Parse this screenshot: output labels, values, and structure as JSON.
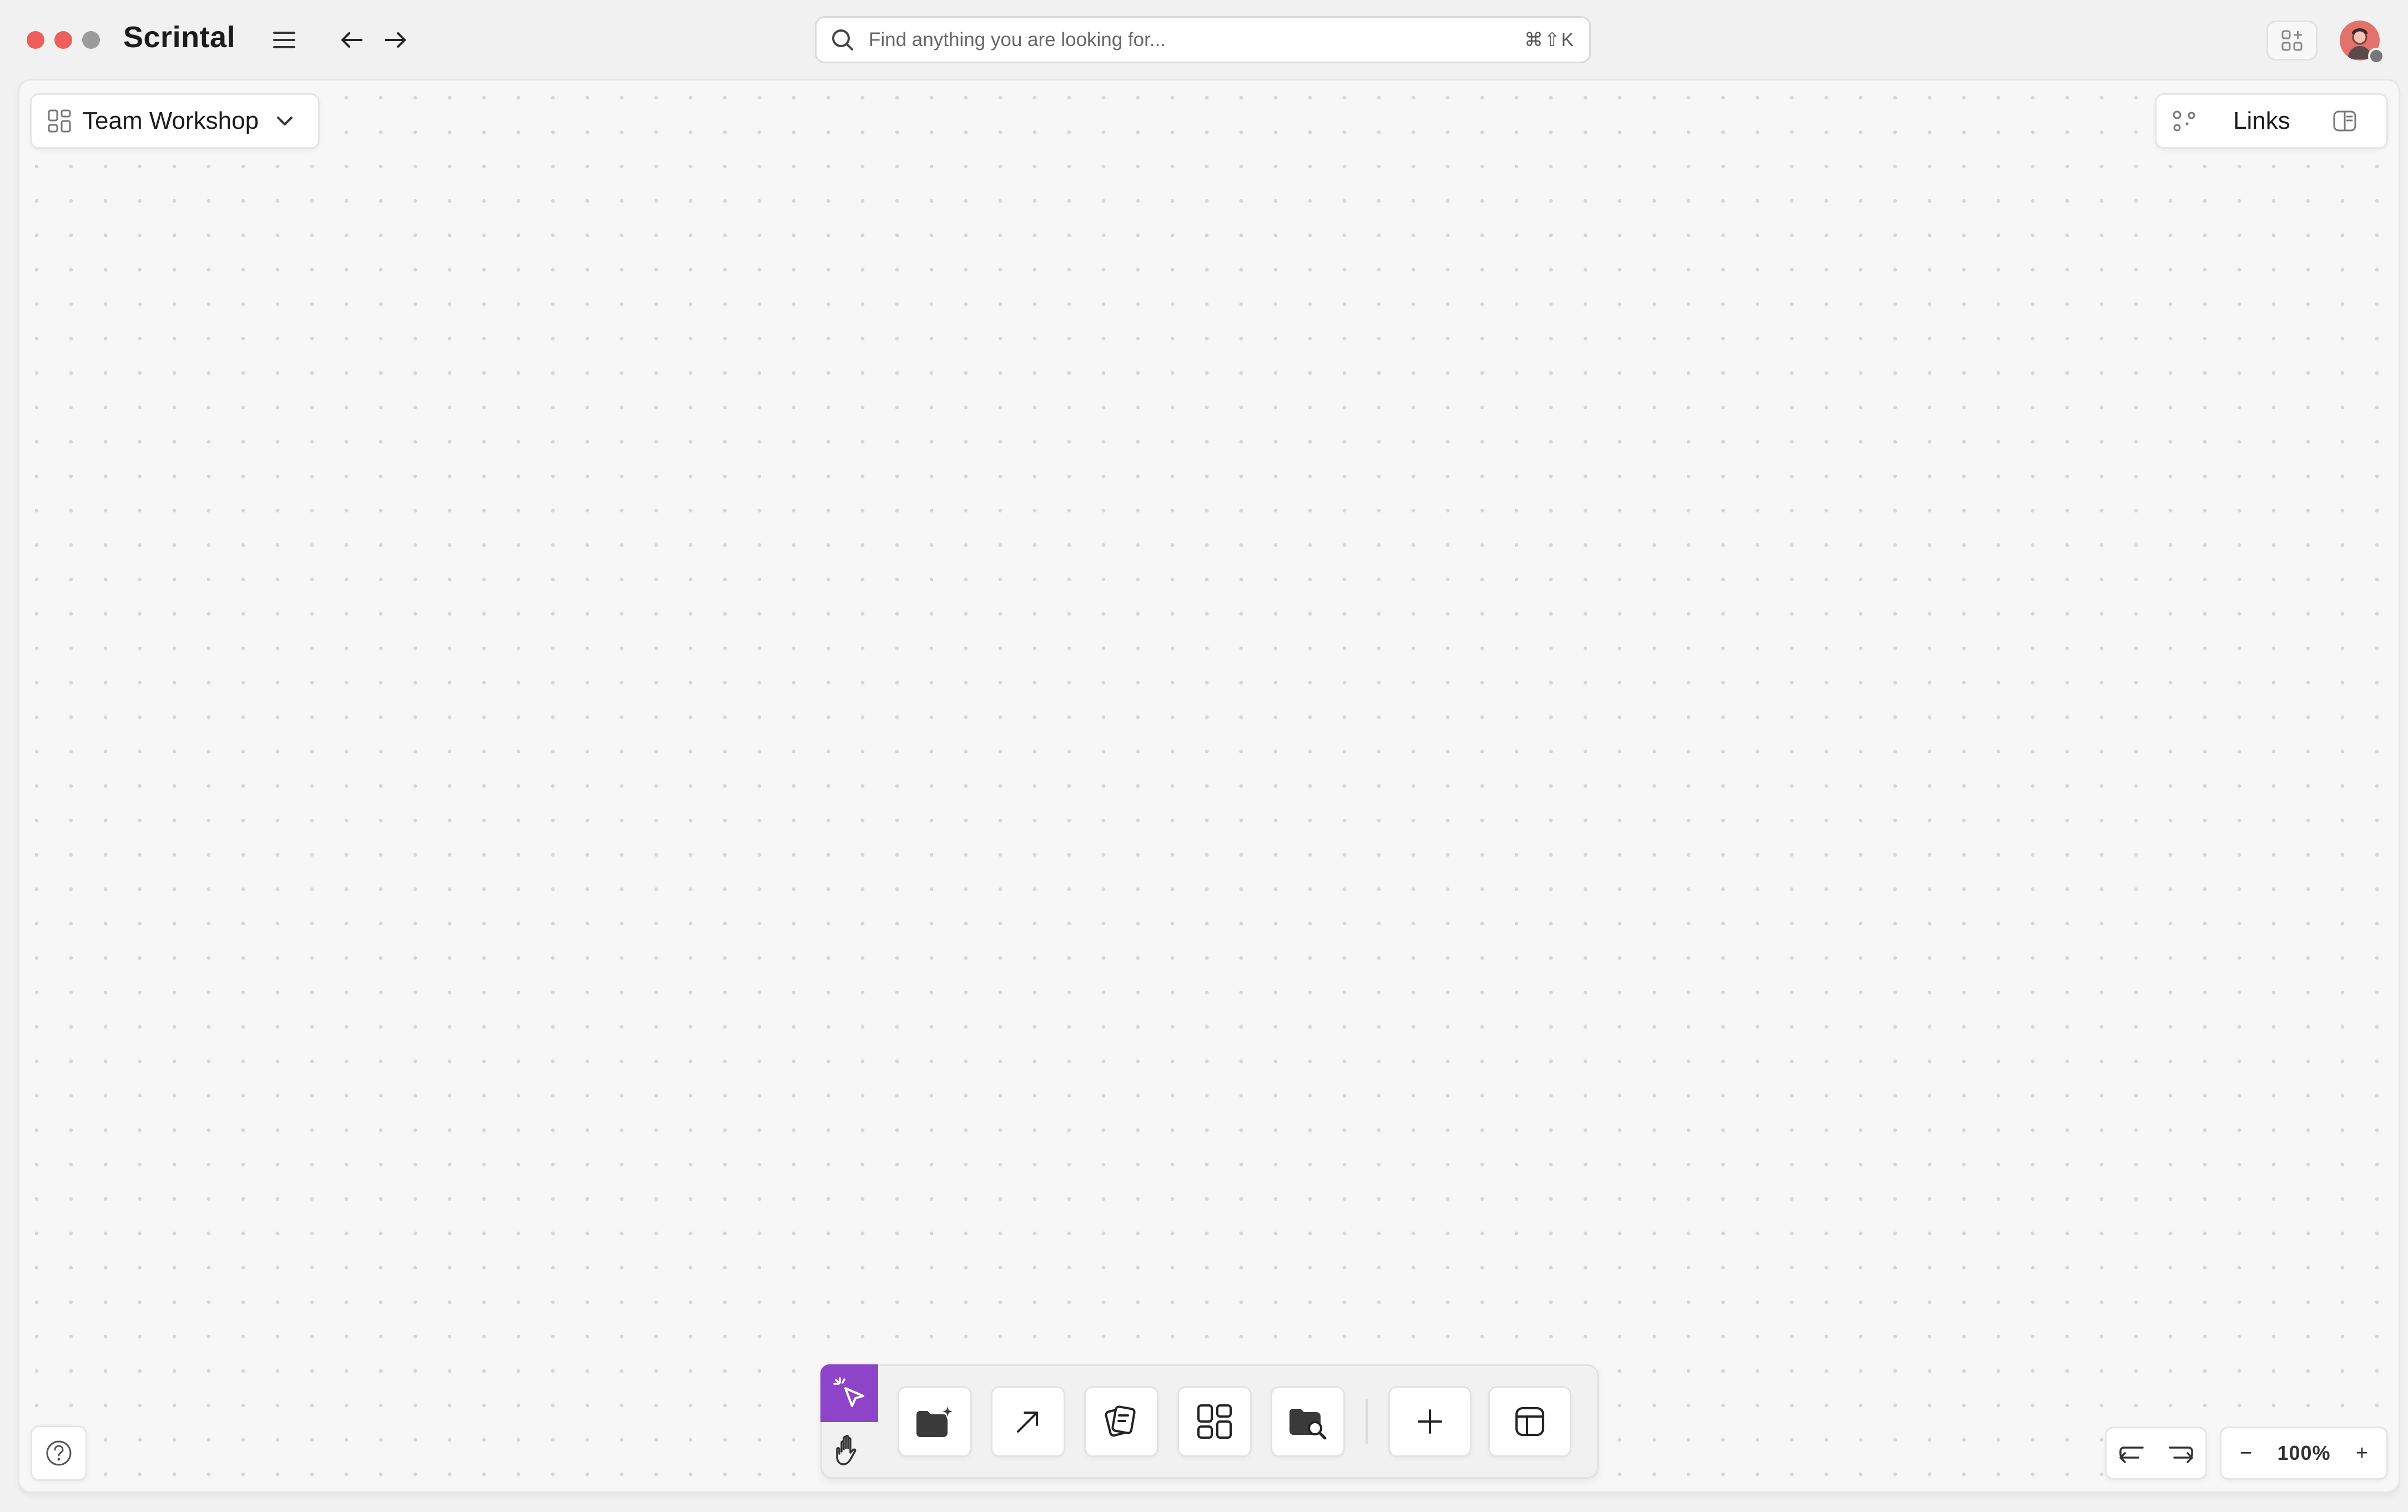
{
  "app": {
    "title": "Scrintal"
  },
  "search": {
    "placeholder": "Find anything you are looking for...",
    "shortcut": "⌘⇧K"
  },
  "workspace": {
    "name": "Team Workshop"
  },
  "links_panel": {
    "label": "Links"
  },
  "zoom": {
    "level": "100%",
    "minus": "−",
    "plus": "+"
  },
  "colors": {
    "accent": "#8e44c9",
    "traffic_close": "#ee5f5b",
    "traffic_minimize": "#ee5f5b",
    "traffic_zoom": "#9b9b9b",
    "canvas_bg": "#f7f7f7",
    "avatar": "#e2736c"
  },
  "icons": {
    "menu": "hamburger-menu-icon",
    "back": "arrow-left-icon",
    "forward": "arrow-right-icon",
    "search": "search-icon",
    "select_tool": "pointer-sparkle-icon",
    "hand_tool": "hand-icon",
    "tools": [
      "folder-sparkle-icon",
      "arrow-up-right-icon",
      "cards-stack-icon",
      "grid-layout-icon",
      "folder-search-icon",
      "plus-icon",
      "layout-panel-icon"
    ]
  }
}
